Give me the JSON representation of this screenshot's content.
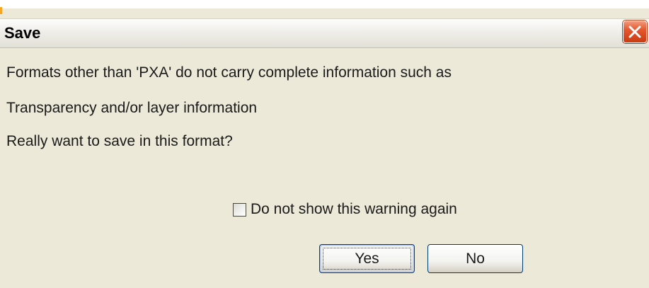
{
  "window": {
    "title": "Save"
  },
  "icons": {
    "close": "close-icon"
  },
  "colors": {
    "dialog_background": "#ece9d8",
    "close_button": "#e5582f",
    "button_border": "#003c74"
  },
  "message": {
    "line1": "Formats other than 'PXA' do not carry complete information such as",
    "line2": "Transparency and/or layer information",
    "line3": "Really want to save in this format?"
  },
  "options": {
    "dont_show_again_label": "Do not show this warning again",
    "dont_show_again_checked": false
  },
  "buttons": {
    "yes_label": "Yes",
    "no_label": "No"
  }
}
